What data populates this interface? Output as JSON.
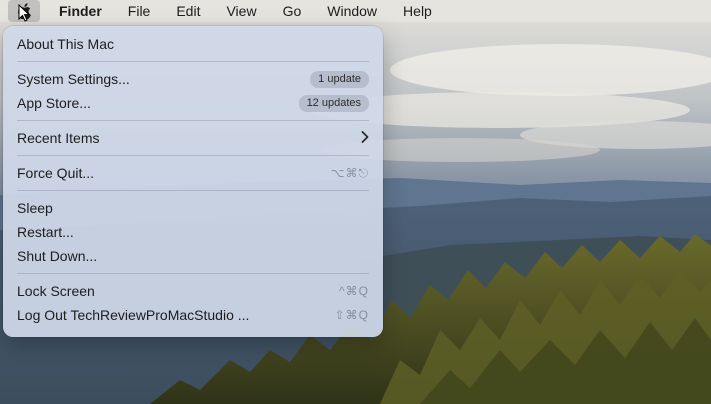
{
  "menubar": {
    "app_name": "Finder",
    "items": [
      "File",
      "Edit",
      "View",
      "Go",
      "Window",
      "Help"
    ]
  },
  "apple_menu": {
    "about": "About This Mac",
    "system_settings": {
      "label": "System Settings...",
      "badge": "1 update"
    },
    "app_store": {
      "label": "App Store...",
      "badge": "12 updates"
    },
    "recent_items": "Recent Items",
    "force_quit": {
      "label": "Force Quit...",
      "shortcut": "⌥⌘⎋"
    },
    "sleep": "Sleep",
    "restart": "Restart...",
    "shut_down": "Shut Down...",
    "lock_screen": {
      "label": "Lock Screen",
      "shortcut": "^⌘Q"
    },
    "log_out": {
      "label": "Log Out TechReviewProMacStudio ...",
      "shortcut": "⇧⌘Q"
    }
  },
  "icons": {
    "apple": "apple-logo-icon",
    "pointer": "mouse-pointer-icon",
    "submenu": "chevron-right-icon"
  }
}
